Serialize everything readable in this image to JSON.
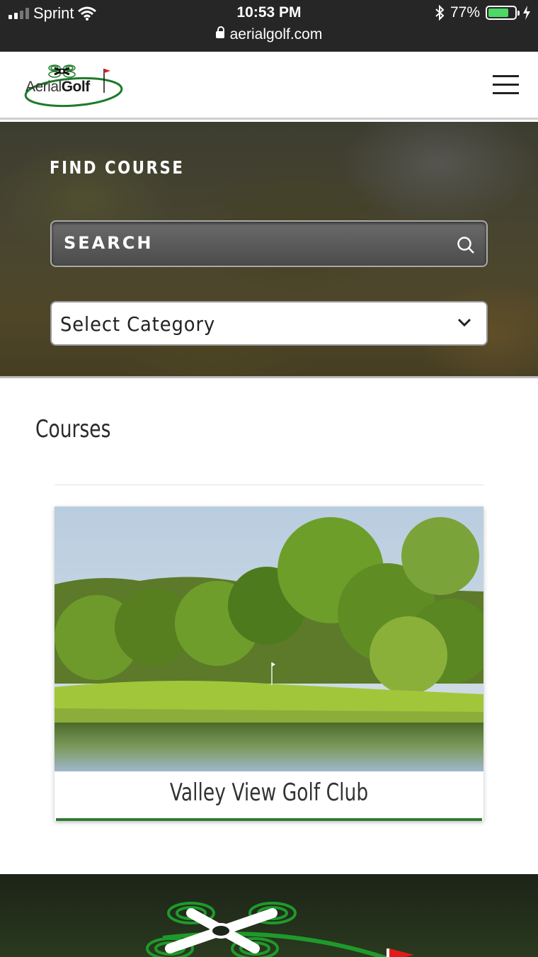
{
  "status_bar": {
    "carrier": "Sprint",
    "time": "10:53 PM",
    "url": "aerialgolf.com",
    "battery": "77%",
    "battery_level": 0.77
  },
  "header": {
    "logo_text_light": "Aerial",
    "logo_text_bold": "Golf",
    "menu_icon": "hamburger-icon"
  },
  "hero": {
    "title": "FIND COURSE",
    "search_placeholder": "SEARCH",
    "category_selected": "Select Category"
  },
  "courses": {
    "heading": "Courses",
    "items": [
      {
        "name": "Valley View Golf Club"
      }
    ]
  },
  "colors": {
    "accent_green": "#2e7d32",
    "status_bar_bg": "#262626",
    "battery_green": "#4cd964"
  }
}
